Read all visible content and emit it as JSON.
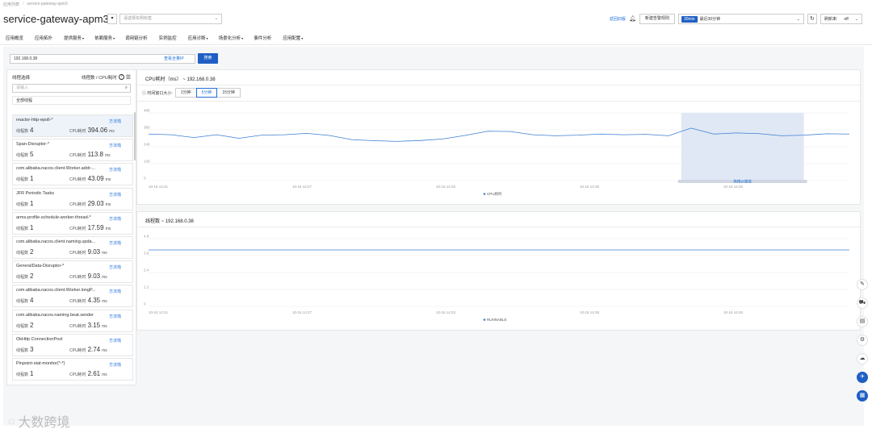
{
  "breadcrumb": {
    "root": "应用列表",
    "sep": "/",
    "current": "service-gateway-apm3"
  },
  "app": {
    "title": "service-gateway-apm3",
    "tag_placeholder": "请选择实例标签"
  },
  "topbar": {
    "back_label": "返回旧版",
    "alert_rule_label": "新建告警规则",
    "time_pill": "30min",
    "time_label": "最近30分钟",
    "refresh_rate_label": "刷新率:",
    "refresh_rate_value": "off"
  },
  "nav": [
    "应用概览",
    "应用拓扑",
    "提供服务",
    "依赖服务",
    "调用链分析",
    "实例监控",
    "应用诊断",
    "场景化分析",
    "事件分析",
    "应用配置"
  ],
  "nav_dropdown": [
    false,
    false,
    true,
    true,
    false,
    false,
    true,
    true,
    false,
    true
  ],
  "search": {
    "ip_value": "192.168.0.38",
    "full_link": "查看全量IP",
    "button": "搜索"
  },
  "thread_panel": {
    "title": "线程选择",
    "sort_label": "线程数 / CPU耗时",
    "search_placeholder": "请输入",
    "all_label": "全部线程",
    "count_label": "线程数",
    "cpu_label": "CPU耗时",
    "unit": "ms",
    "stack_label": "方法栈",
    "threads": [
      {
        "name": "reactor-http-epoll-*",
        "count": "4",
        "cpu": "394.06"
      },
      {
        "name": "Span-Disruptor-*",
        "count": "5",
        "cpu": "113.8"
      },
      {
        "name": "com.alibaba.nacos.client.Worker.addr-...",
        "count": "1",
        "cpu": "43.09"
      },
      {
        "name": "JFR Periodic Tasks",
        "count": "1",
        "cpu": "29.03"
      },
      {
        "name": "arms-profile-schedule-worker-thread-*",
        "count": "1",
        "cpu": "17.59"
      },
      {
        "name": "com.alibaba.nacos.client.naming.upda...",
        "count": "2",
        "cpu": "9.03"
      },
      {
        "name": "GeneralData-Disruptor-*",
        "count": "2",
        "cpu": "9.03"
      },
      {
        "name": "com.alibaba.nacos.client.Worker.longP...",
        "count": "4",
        "cpu": "4.35"
      },
      {
        "name": "com.alibaba.nacos.naming.beat.sender",
        "count": "2",
        "cpu": "3.15"
      },
      {
        "name": "OkHttp ConnectionPool",
        "count": "3",
        "cpu": "2.74"
      },
      {
        "name": "Pinpoint-stat-monitor(*-*)",
        "count": "1",
        "cpu": "2.61"
      }
    ]
  },
  "cpu_card": {
    "title": "CPU耗时（ms） ~ 192.168.0.38",
    "window_label": "时间窗口大小:",
    "windows": [
      "1分钟",
      "5分钟",
      "15分钟"
    ],
    "active_window": 1,
    "brush_label": "拖拽以缩放",
    "chart_data": {
      "type": "line",
      "x": [
        "10-16 14:21",
        "10-16 14:27",
        "10-16 14:33",
        "10-16 14:39",
        "10-16 14:45"
      ],
      "series": [
        {
          "name": "CPU耗时",
          "values": [
            330,
            325,
            305,
            325,
            300,
            322,
            325,
            335,
            320,
            290,
            283,
            278,
            284,
            295,
            320,
            350,
            348,
            325,
            318,
            322,
            330,
            325,
            328,
            318,
            372,
            330,
            338,
            333,
            318,
            322,
            332,
            330
          ]
        }
      ],
      "ylim": [
        0,
        480
      ],
      "yticks": [
        "480",
        "360",
        "240",
        "120",
        "0"
      ],
      "xlabel": "",
      "ylabel": "",
      "legend": "bottom-center",
      "brush_range": [
        0.76,
        0.935
      ]
    }
  },
  "thread_card": {
    "title": "线程数 ~ 192.168.0.38",
    "chart_data": {
      "type": "line",
      "x": [
        "10-16 14:21",
        "10-16 14:27",
        "10-16 14:33",
        "10-16 14:39",
        "10-16 14:45"
      ],
      "series": [
        {
          "name": "RUNNABLE",
          "values": [
            4,
            4
          ]
        }
      ],
      "ylim": [
        0,
        4.8
      ],
      "yticks": [
        "4.8",
        "3.6",
        "2.4",
        "1.2",
        "0"
      ],
      "xlabel": "",
      "ylabel": "",
      "legend": "bottom-center"
    }
  },
  "side_rail": [
    "edit-icon",
    "cart-icon",
    "doc-icon",
    "gear-icon",
    "bell-cloud-icon",
    "plane-icon",
    "grid-icon"
  ],
  "watermark": {
    "text": "大数跨境"
  },
  "colors": {
    "accent": "#1f5fc4",
    "line": "#3b7fd4",
    "brush": "#dbe4f3"
  }
}
